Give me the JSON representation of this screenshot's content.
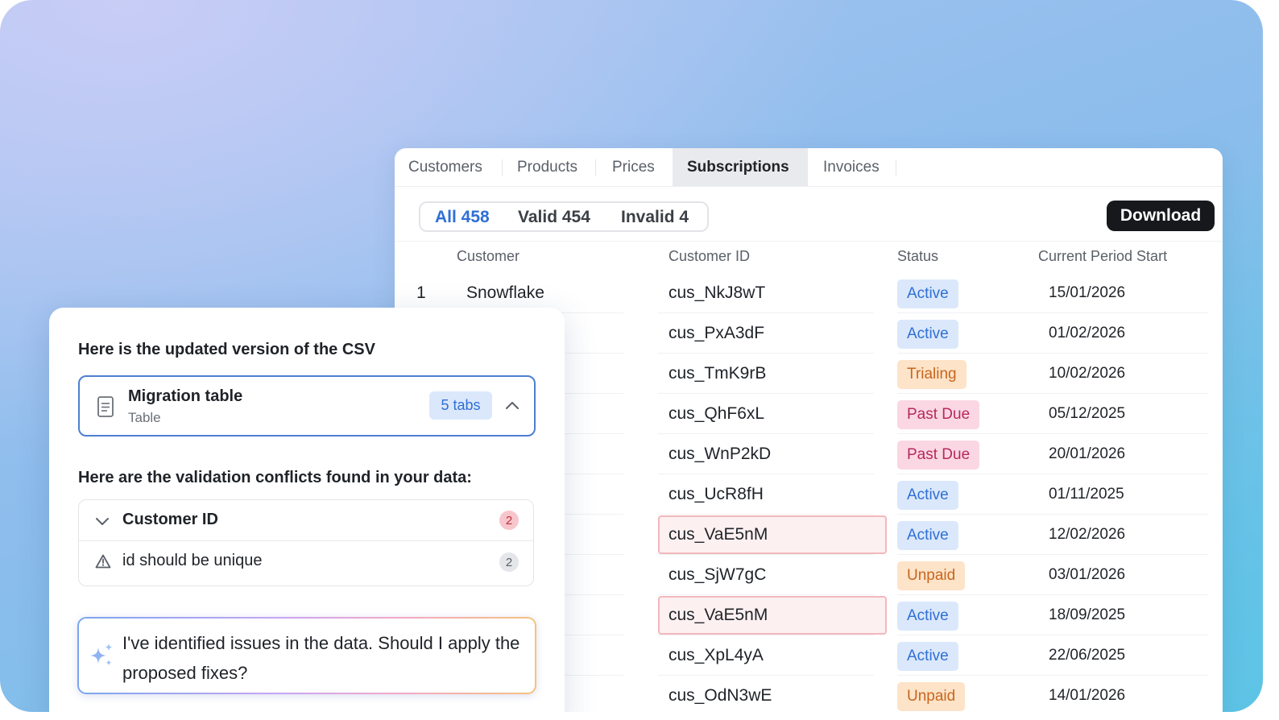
{
  "colors": {
    "accent": "#2f6fd6",
    "active_bg": "#dbe8fb",
    "active_fg": "#2f6fd6",
    "trialing_bg": "#fde3c8",
    "trialing_fg": "#c8661e",
    "pastdue_bg": "#fbd7e3",
    "pastdue_fg": "#b52a5d",
    "unpaid_bg": "#fde3c8",
    "unpaid_fg": "#c8661e"
  },
  "tabs": [
    {
      "label": "Customers",
      "active": false
    },
    {
      "label": "Products",
      "active": false
    },
    {
      "label": "Prices",
      "active": false
    },
    {
      "label": "Subscriptions",
      "active": true
    },
    {
      "label": "Invoices",
      "active": false
    }
  ],
  "filters": {
    "all_label": "All 458",
    "valid_label": "Valid 454",
    "invalid_label": "Invalid 4",
    "selected": "all"
  },
  "download_label": "Download",
  "table": {
    "columns": [
      "Customer",
      "Customer ID",
      "Status",
      "Current Period Start"
    ],
    "rows": [
      {
        "num": "1",
        "customer": "Snowflake",
        "customer_id": "cus_NkJ8wT",
        "status": "Active",
        "date": "15/01/2026",
        "conflict": false
      },
      {
        "num": "",
        "customer": "",
        "customer_id": "cus_PxA3dF",
        "status": "Active",
        "date": "01/02/2026",
        "conflict": false
      },
      {
        "num": "",
        "customer": "",
        "customer_id": "cus_TmK9rB",
        "status": "Trialing",
        "date": "10/02/2026",
        "conflict": false
      },
      {
        "num": "",
        "customer": "",
        "customer_id": "cus_QhF6xL",
        "status": "Past Due",
        "date": "05/12/2025",
        "conflict": false
      },
      {
        "num": "",
        "customer": "",
        "customer_id": "cus_WnP2kD",
        "status": "Past Due",
        "date": "20/01/2026",
        "conflict": false
      },
      {
        "num": "",
        "customer": "",
        "customer_id": "cus_UcR8fH",
        "status": "Active",
        "date": "01/11/2025",
        "conflict": false
      },
      {
        "num": "",
        "customer": "",
        "customer_id": "cus_VaE5nM",
        "status": "Active",
        "date": "12/02/2026",
        "conflict": true
      },
      {
        "num": "",
        "customer": "",
        "customer_id": "cus_SjW7gC",
        "status": "Unpaid",
        "date": "03/01/2026",
        "conflict": false
      },
      {
        "num": "",
        "customer": "",
        "customer_id": "cus_VaE5nM",
        "status": "Active",
        "date": "18/09/2025",
        "conflict": true
      },
      {
        "num": "",
        "customer": "",
        "customer_id": "cus_XpL4yA",
        "status": "Active",
        "date": "22/06/2025",
        "conflict": false
      },
      {
        "num": "",
        "customer": "",
        "customer_id": "cus_OdN3wE",
        "status": "Unpaid",
        "date": "14/01/2026",
        "conflict": false
      }
    ]
  },
  "chat": {
    "intro": "Here is the updated version of the CSV",
    "attachment": {
      "title": "Migration table",
      "subtitle": "Table",
      "tabs_count": "5 tabs",
      "icon": "document-icon",
      "toggle_icon": "chevron-up-icon"
    },
    "conflicts_heading": "Here are the validation conflicts found in your data:",
    "conflict_group": {
      "title": "Customer ID",
      "count": "2",
      "rule": "id should be unique",
      "rule_count": "2",
      "icon": "chevron-down-icon",
      "rule_icon": "warning-icon"
    },
    "ai_message": "I've identified issues in the data. Should I apply the proposed fixes?",
    "ai_icon": "sparkle-icon"
  }
}
